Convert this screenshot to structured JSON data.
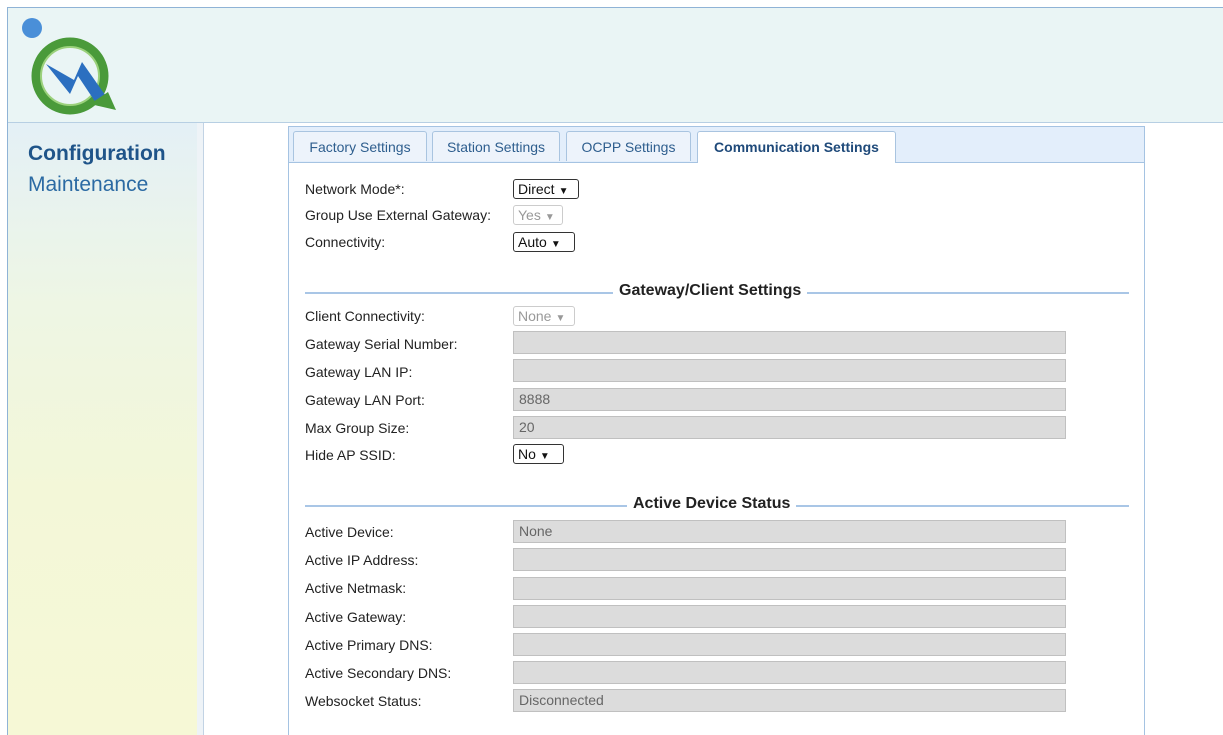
{
  "nav": {
    "configuration": "Configuration",
    "maintenance": "Maintenance"
  },
  "tabs": [
    {
      "label": "Factory Settings",
      "active": false
    },
    {
      "label": "Station Settings",
      "active": false
    },
    {
      "label": "OCPP Settings",
      "active": false
    },
    {
      "label": "Communication Settings",
      "active": true
    }
  ],
  "general": {
    "network_mode": {
      "label": "Network Mode*:",
      "value": "Direct"
    },
    "group_use_external_gateway": {
      "label": "Group Use External Gateway:",
      "value": "Yes"
    },
    "connectivity": {
      "label": "Connectivity:",
      "value": "Auto"
    }
  },
  "gateway_section": {
    "title": "Gateway/Client Settings",
    "client_connectivity": {
      "label": "Client Connectivity:",
      "value": "None"
    },
    "gateway_serial_number": {
      "label": "Gateway Serial Number:",
      "value": ""
    },
    "gateway_lan_ip": {
      "label": "Gateway LAN IP:",
      "value": ""
    },
    "gateway_lan_port": {
      "label": "Gateway LAN Port:",
      "value": "8888"
    },
    "max_group_size": {
      "label": "Max Group Size:",
      "value": "20"
    },
    "hide_ap_ssid": {
      "label": "Hide AP SSID:",
      "value": "No"
    }
  },
  "status_section": {
    "title": "Active Device Status",
    "active_device": {
      "label": "Active Device:",
      "value": "None"
    },
    "active_ip_address": {
      "label": "Active IP Address:",
      "value": ""
    },
    "active_netmask": {
      "label": "Active Netmask:",
      "value": ""
    },
    "active_gateway": {
      "label": "Active Gateway:",
      "value": ""
    },
    "active_primary_dns": {
      "label": "Active Primary DNS:",
      "value": ""
    },
    "active_secondary_dns": {
      "label": "Active Secondary DNS:",
      "value": ""
    },
    "websocket_status": {
      "label": "Websocket Status:",
      "value": "Disconnected"
    }
  },
  "colors": {
    "accent": "#1f5489",
    "tab_bar": "#e3eefb",
    "header_bg": "#eaf5f5",
    "field_disabled": "#dcdcdc",
    "logo_green": "#4a9a3a",
    "logo_blue": "#2b6fc0"
  },
  "icons": {
    "logo": "charging-station-logo-icon",
    "dropdown": "chevron-down-icon"
  }
}
